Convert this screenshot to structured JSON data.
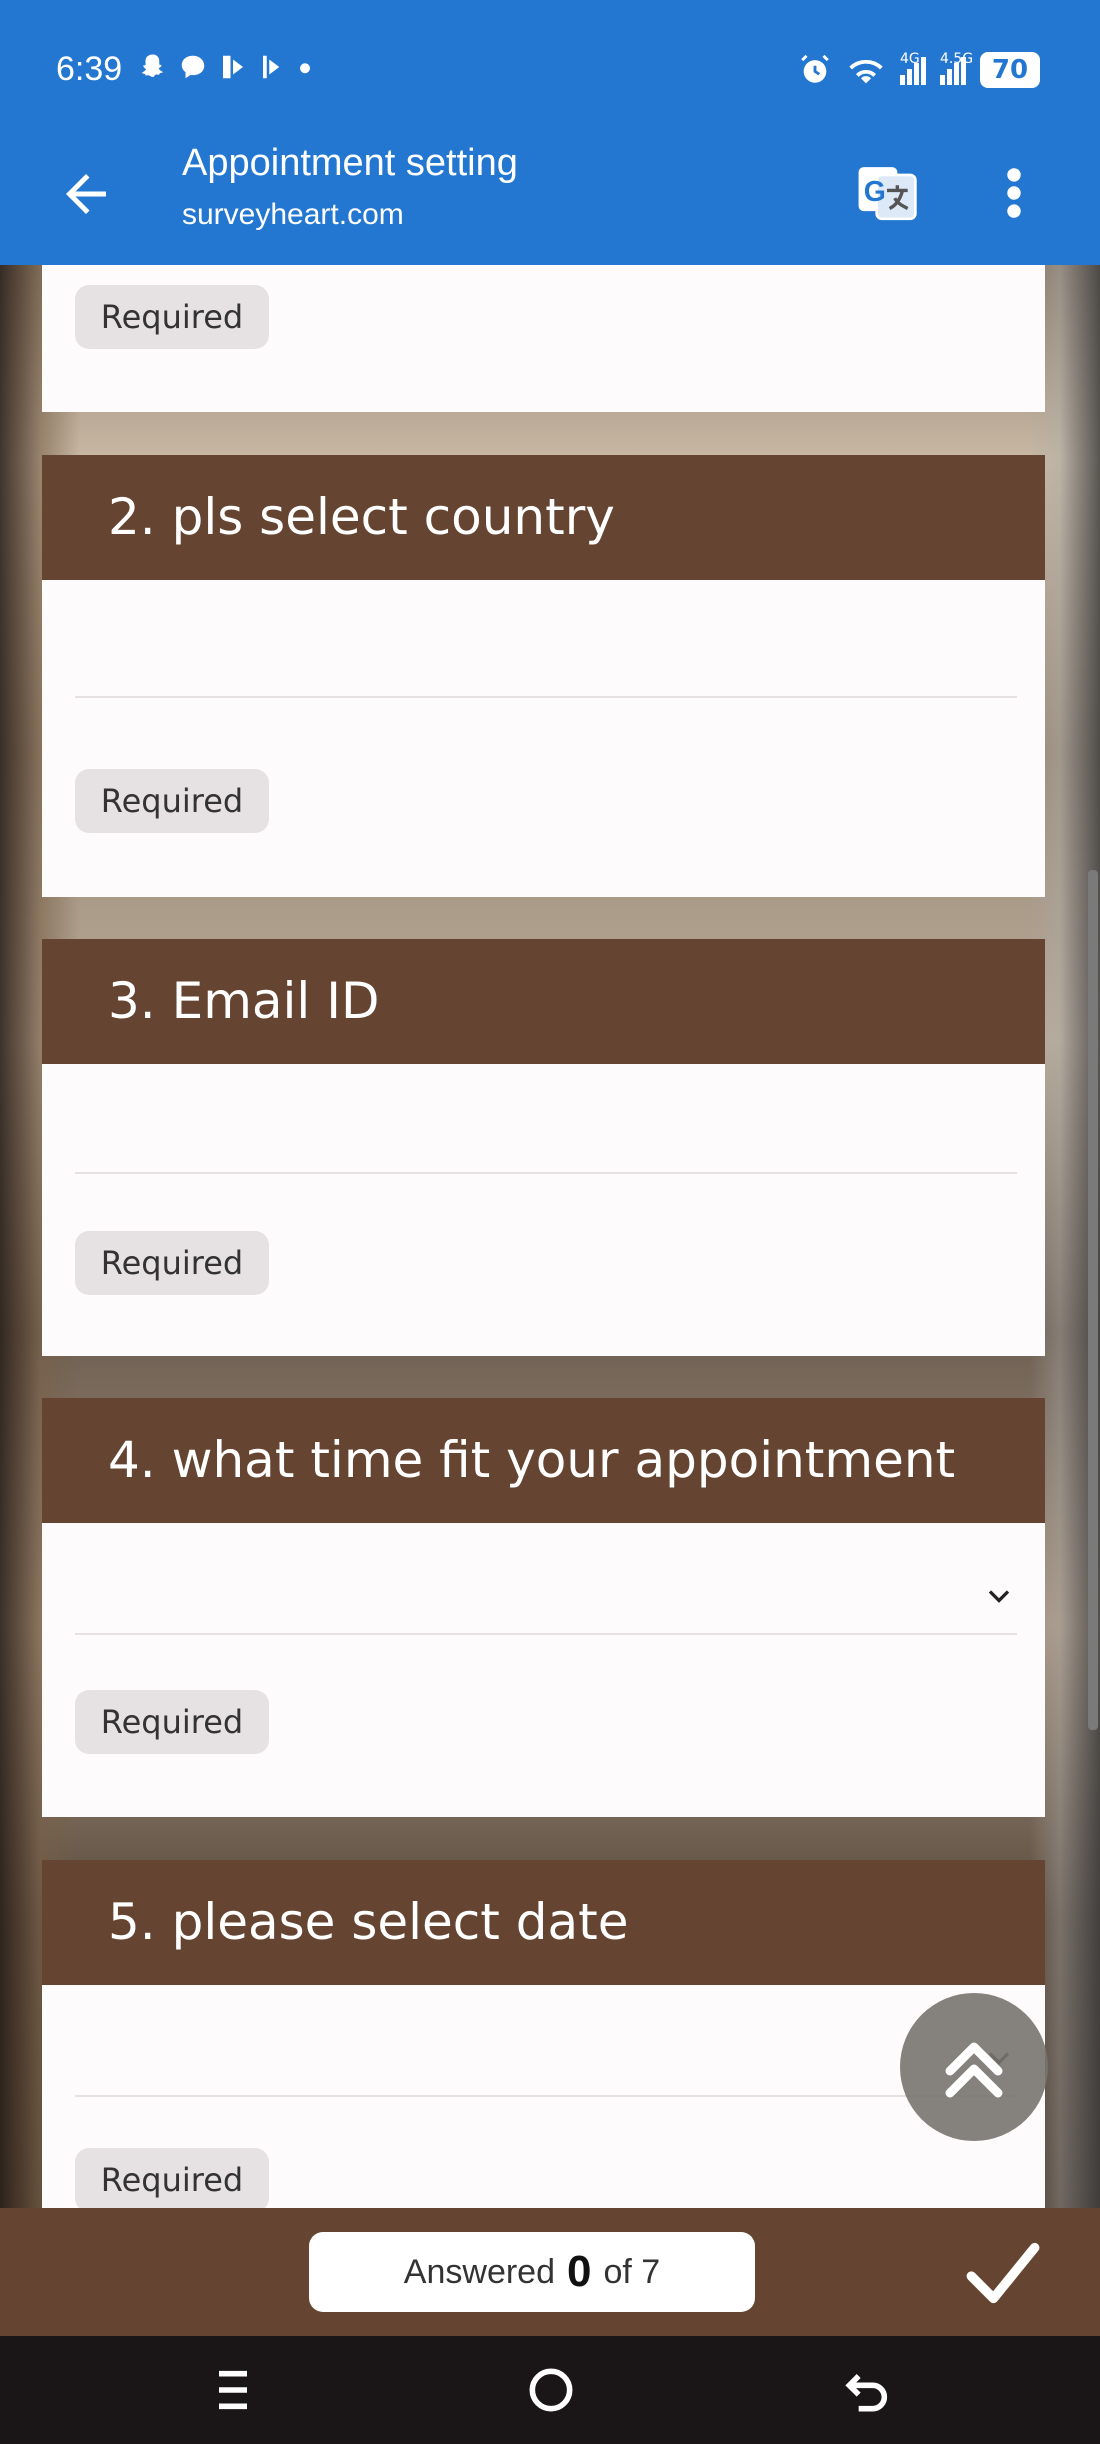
{
  "status_bar": {
    "time": "6:39",
    "left_icons": [
      "snapchat-icon",
      "chat-icon",
      "media-icon",
      "media-icon",
      "dot-icon"
    ],
    "right_icons": [
      "alarm-icon",
      "wifi-icon",
      "signal-4g-icon",
      "signal-4-5g-icon"
    ],
    "signal_1_label": "4G",
    "signal_2_label": "4.5G",
    "battery": "70"
  },
  "app_bar": {
    "title": "Appointment setting",
    "subtitle": "surveyheart.com",
    "back_icon": "arrow-left-icon",
    "translate_icon": "translate-icon",
    "more_icon": "more-vertical-icon"
  },
  "questions": [
    {
      "number_title": "",
      "required": "Required"
    },
    {
      "number_title": "2. pls select country",
      "required": "Required",
      "type": "text"
    },
    {
      "number_title": "3. Email ID",
      "required": "Required",
      "type": "text"
    },
    {
      "number_title": "4. what time fit your appointment",
      "required": "Required",
      "type": "dropdown"
    },
    {
      "number_title": "5. please select date",
      "required": "Required",
      "type": "dropdown"
    }
  ],
  "footer": {
    "answered_label": "Answered",
    "answered_count": "0",
    "answered_total": "of 7",
    "submit_icon": "checkmark-icon"
  },
  "colors": {
    "primary": "#2477d1",
    "card_header": "#654531",
    "card_bg": "#fdfbfc",
    "chip_bg": "#e6e2e3"
  },
  "nav_bar": {
    "icons": [
      "recents-icon",
      "home-icon",
      "back-icon"
    ]
  }
}
